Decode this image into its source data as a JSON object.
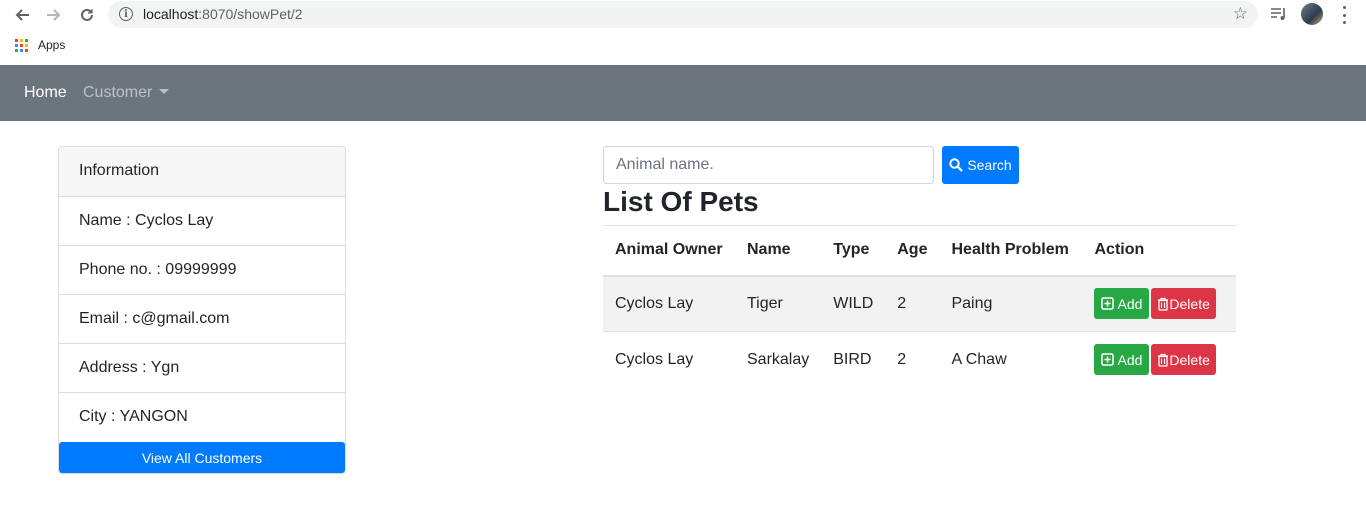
{
  "browser": {
    "url_host": "localhost",
    "url_rest": ":8070/showPet/2",
    "bookmarks_apps_label": "Apps",
    "apps_icon_colors": [
      "#ea4335",
      "#fbbc04",
      "#34a853",
      "#4285f4",
      "#ea4335",
      "#fbbc04",
      "#34a853",
      "#4285f4",
      "#ea4335"
    ]
  },
  "navbar": {
    "home_label": "Home",
    "customer_label": "Customer",
    "bg_color": "#6c757d"
  },
  "info_card": {
    "header": "Information",
    "items": [
      "Name : Cyclos Lay",
      "Phone no. : 09999999",
      "Email : c@gmail.com",
      "Address : Ygn",
      "City : YANGON"
    ],
    "view_all_label": "View All Customers"
  },
  "search": {
    "placeholder": "Animal name.",
    "button_label": "Search"
  },
  "list_title": "List Of Pets",
  "table": {
    "headers": [
      "Animal Owner",
      "Name",
      "Type",
      "Age",
      "Health Problem",
      "Action"
    ],
    "rows": [
      {
        "owner": "Cyclos Lay",
        "name": "Tiger",
        "type": "WILD",
        "age": "2",
        "health": "Paing"
      },
      {
        "owner": "Cyclos Lay",
        "name": "Sarkalay",
        "type": "BIRD",
        "age": "2",
        "health": "A Chaw"
      }
    ],
    "add_label": "Add",
    "delete_label": "Delete"
  },
  "colors": {
    "primary": "#007bff",
    "success": "#28a745",
    "danger": "#dc3545"
  }
}
